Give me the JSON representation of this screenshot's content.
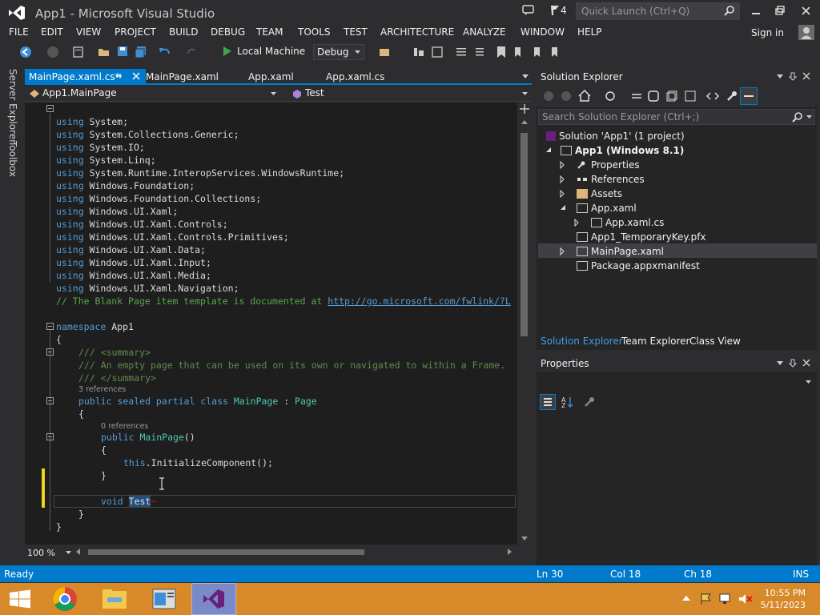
{
  "window": {
    "title": "App1 - Microsoft Visual Studio",
    "notification_count": "4",
    "quick_launch_placeholder": "Quick Launch (Ctrl+Q)"
  },
  "menu": [
    "FILE",
    "EDIT",
    "VIEW",
    "PROJECT",
    "BUILD",
    "DEBUG",
    "TEAM",
    "TOOLS",
    "TEST",
    "ARCHITECTURE",
    "ANALYZE",
    "WINDOW",
    "HELP"
  ],
  "account": {
    "sign_in": "Sign in"
  },
  "toolbar": {
    "run_target": "Local Machine",
    "configuration": "Debug"
  },
  "side_tabs": [
    "Server Explorer",
    "Toolbox"
  ],
  "doc_tabs": [
    {
      "label": "MainPage.xaml.cs*",
      "active": true
    },
    {
      "label": "MainPage.xaml",
      "active": false
    },
    {
      "label": "App.xaml",
      "active": false
    },
    {
      "label": "App.xaml.cs",
      "active": false
    }
  ],
  "navbar": {
    "type_selector": "App1.MainPage",
    "member_selector": "Test"
  },
  "code": {
    "usings": [
      "System",
      "System.Collections.Generic",
      "System.IO",
      "System.Linq",
      "System.Runtime.InteropServices.WindowsRuntime",
      "Windows.Foundation",
      "Windows.Foundation.Collections",
      "Windows.UI.Xaml",
      "Windows.UI.Xaml.Controls",
      "Windows.UI.Xaml.Controls.Primitives",
      "Windows.UI.Xaml.Data",
      "Windows.UI.Xaml.Input",
      "Windows.UI.Xaml.Media",
      "Windows.UI.Xaml.Navigation"
    ],
    "comment_prefix": "// The Blank Page item template is documented at ",
    "comment_link": "http://go.microsoft.com/fwlink/?L",
    "namespace_name": "App1",
    "summary_open": "/// <summary>",
    "summary_text": "/// An empty page that can be used on its own or navigated to within a Frame.",
    "summary_close": "/// </summary>",
    "class_refs": "3 references",
    "class_name": "MainPage",
    "base_class": "Page",
    "ctor_refs": "0 references",
    "ctor_call": "InitializeComponent",
    "method_name": "Test"
  },
  "zoom": "100 %",
  "solution_explorer": {
    "title": "Solution Explorer",
    "search_placeholder": "Search Solution Explorer (Ctrl+;)",
    "solution": "Solution 'App1' (1 project)",
    "project": "App1 (Windows 8.1)",
    "items": [
      "Properties",
      "References",
      "Assets",
      "App.xaml",
      "App.xaml.cs",
      "App1_TemporaryKey.pfx",
      "MainPage.xaml",
      "Package.appxmanifest"
    ],
    "tabs": [
      "Solution Explorer",
      "Team Explorer",
      "Class View"
    ]
  },
  "properties": {
    "title": "Properties"
  },
  "status": {
    "state": "Ready",
    "line": "Ln 30",
    "col": "Col 18",
    "ch": "Ch 18",
    "mode": "INS"
  },
  "taskbar": {
    "time": "10:55 PM",
    "date": "5/11/2023"
  },
  "colors": {
    "accent": "#007acc",
    "taskbar": "#d88a2a",
    "caret_marker": "#efd31c"
  }
}
